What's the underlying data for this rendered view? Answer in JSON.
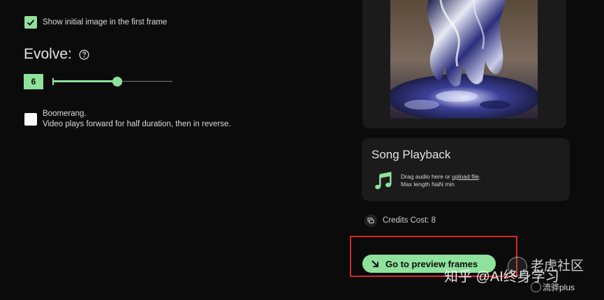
{
  "settings": {
    "show_initial_image": {
      "label": "Show initial image in the first frame",
      "checked": true
    },
    "evolve": {
      "title": "Evolve:",
      "value": "6",
      "fraction": 0.54
    },
    "boomerang": {
      "title": "Boomerang.",
      "description": "Video plays forward for half duration, then in reverse.",
      "checked": false
    }
  },
  "song_playback": {
    "title": "Song Playback",
    "drag_text": "Drag audio here or",
    "upload_link": "upload file",
    "drag_suffix": ".",
    "max_length": "Max length NaN min"
  },
  "credits": {
    "text": "Credits Cost: 8"
  },
  "preview_button": {
    "label": "Go to preview frames"
  },
  "watermark": {
    "main": "知乎 @AI终身学习",
    "side": "老虎社区",
    "small": "流骅plus"
  },
  "colors": {
    "accent": "#8ee29b",
    "background": "#0b0b0b",
    "card": "#1b1b1b",
    "highlight": "#d62828"
  },
  "icons": {
    "checkbox": "check-icon",
    "help": "question-circle-icon",
    "music": "music-note-icon",
    "credits": "credits-icon",
    "arrow": "arrow-down-right-icon"
  }
}
